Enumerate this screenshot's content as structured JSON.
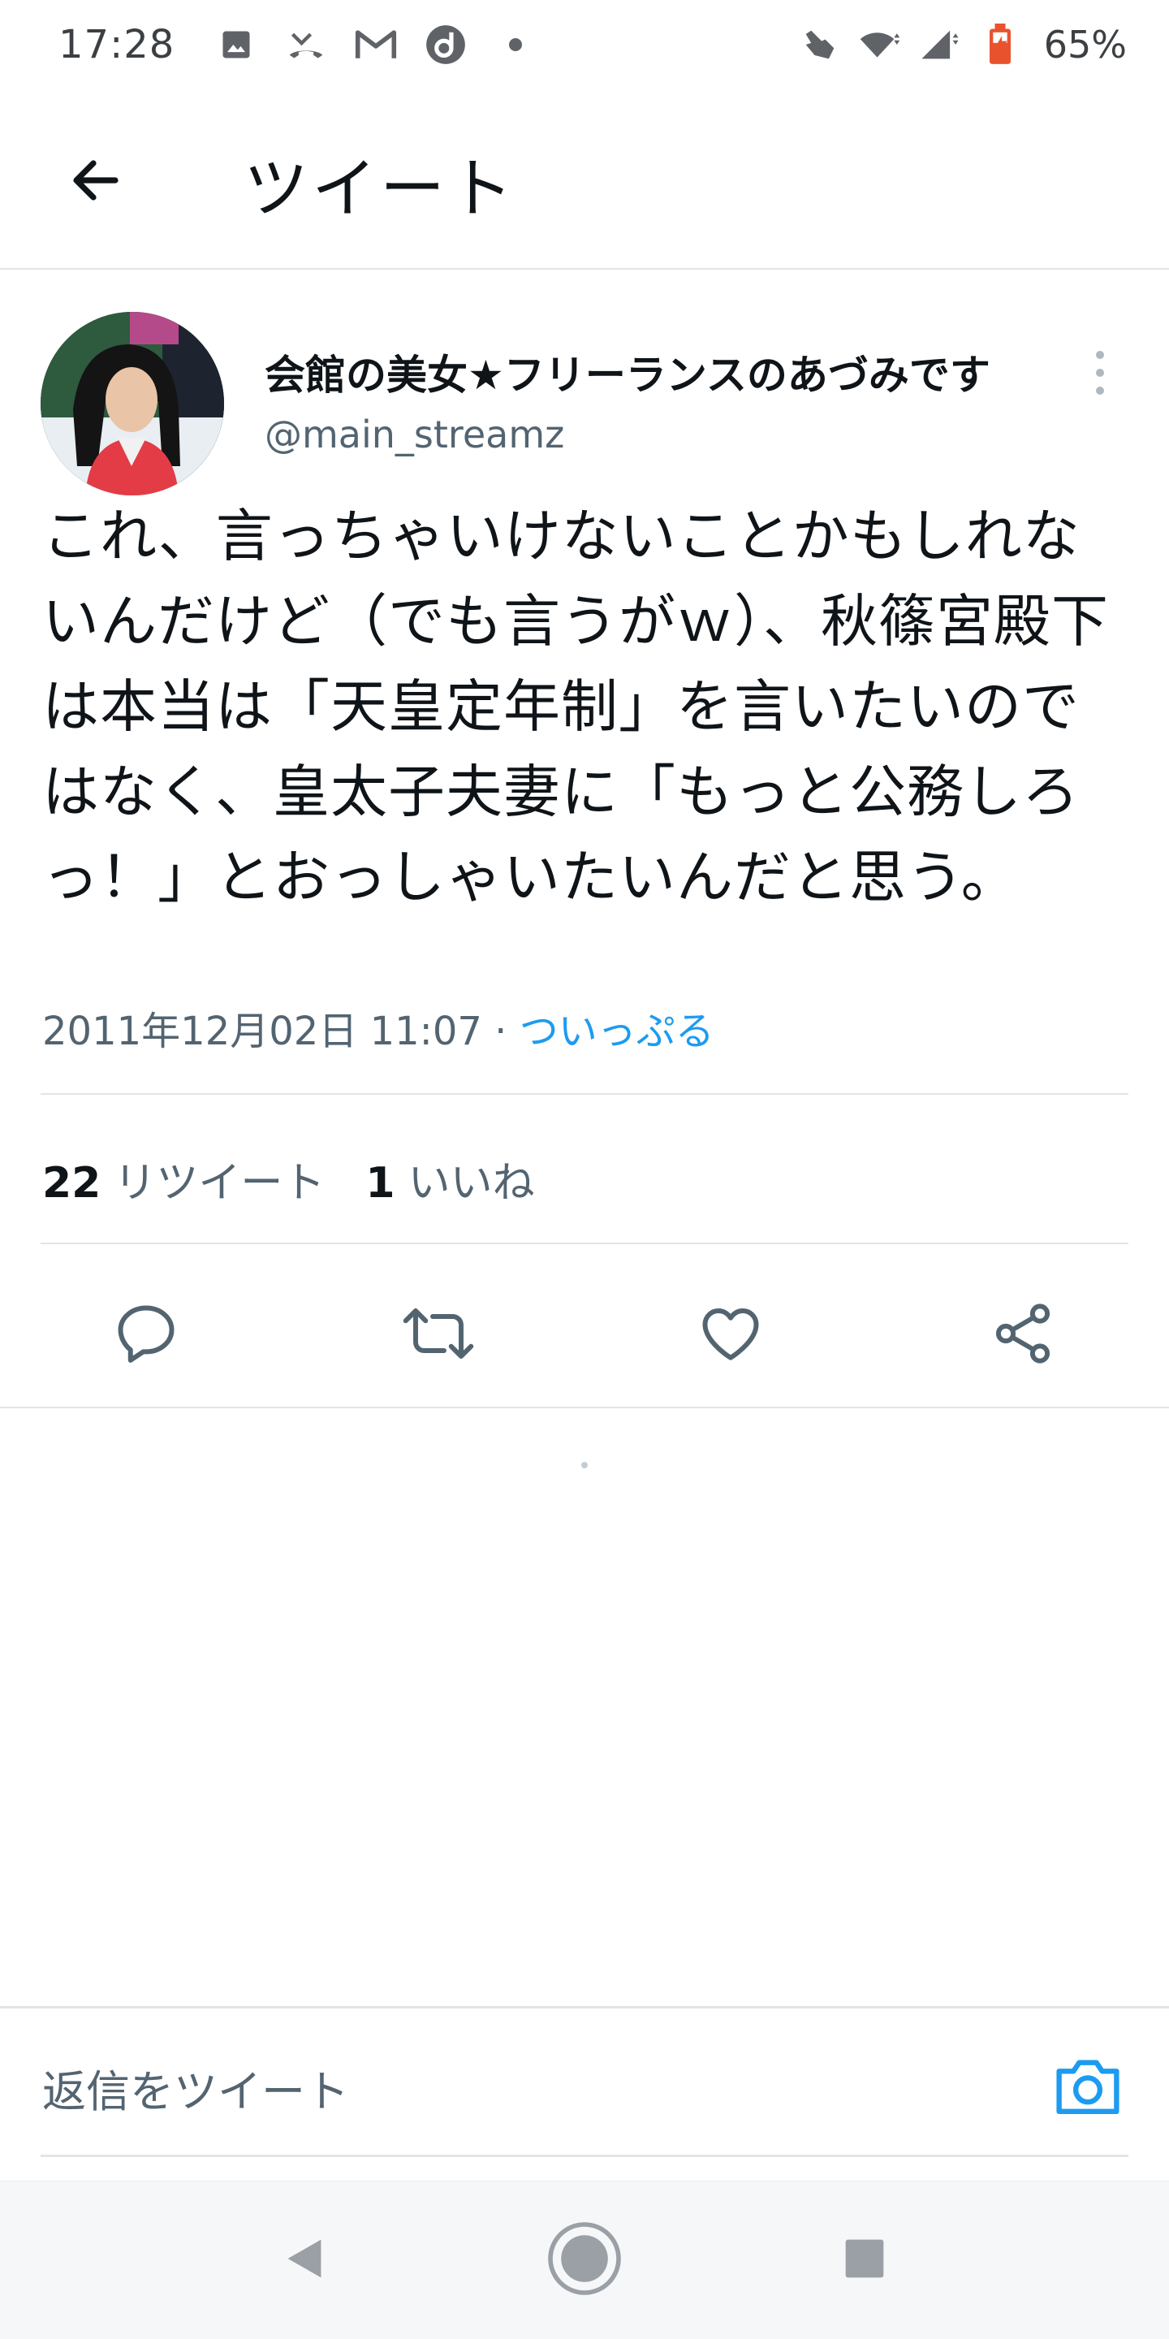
{
  "status_bar": {
    "time": "17:28",
    "battery": "65%",
    "icons_left": [
      "image-icon",
      "missed-call-icon",
      "gmail-icon",
      "d-app-icon",
      "notification-dot-icon"
    ],
    "icons_right": [
      "gesture-icon",
      "wifi-icon",
      "signal-icon",
      "battery-icon"
    ]
  },
  "header": {
    "title": "ツイート"
  },
  "tweet": {
    "author_name": "会館の美女★フリーランスのあづみです",
    "author_handle": "@main_streamz",
    "text": "これ、言っちゃいけないことかもしれないんだけど（でも言うがｗ）、秋篠宮殿下は本当は「天皇定年制」を言いたいのではなく、皇太子夫妻に「もっと公務しろっ！」とおっしゃいたいんだと思う。",
    "timestamp": "2011年12月02日 11:07",
    "separator": " · ",
    "source": "ついっぷる",
    "retweet_count": "22",
    "retweet_label": "リツイート",
    "like_count": "1",
    "like_label": "いいね"
  },
  "reply": {
    "placeholder": "返信をツイート"
  },
  "colors": {
    "accent": "#1d9bf0",
    "secondary_text": "#536471",
    "primary_text": "#0f1419",
    "divider": "#e1e5e8"
  }
}
